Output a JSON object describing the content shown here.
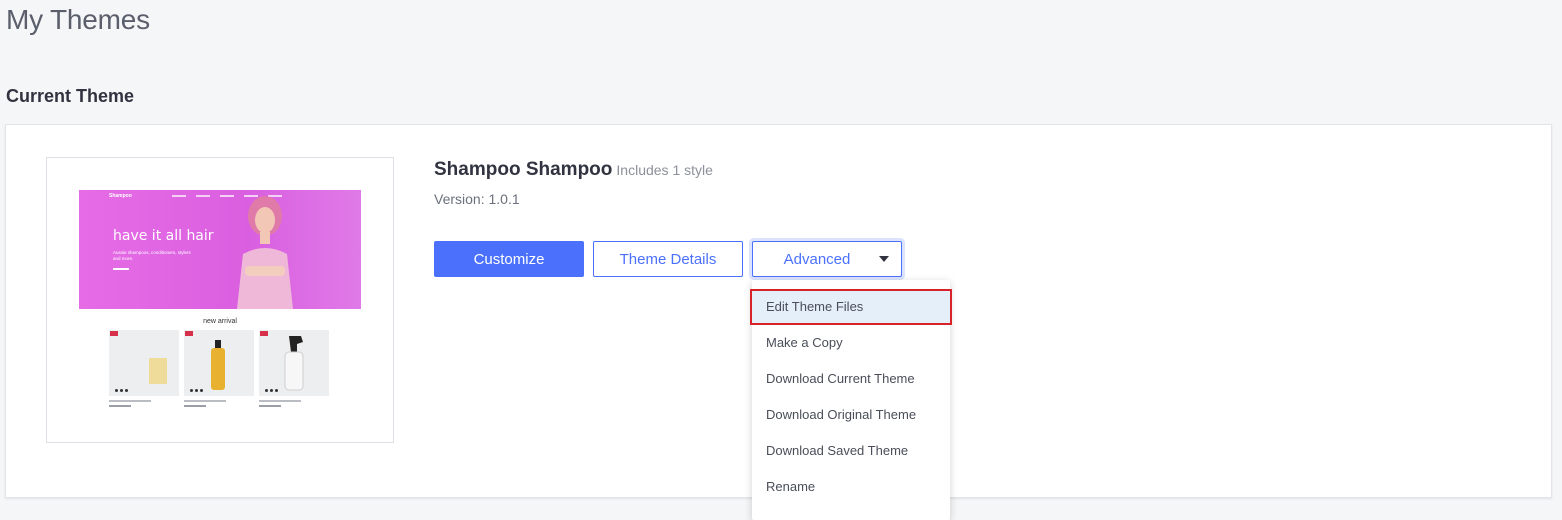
{
  "page": {
    "title": "My Themes"
  },
  "section": {
    "current_theme_label": "Current Theme"
  },
  "theme": {
    "name": "Shampoo Shampoo",
    "styles": "Includes 1 style",
    "version": "Version: 1.0.1",
    "preview": {
      "brand": "Shampoo",
      "headline": "have it all hair",
      "subtext": "Aussie shampoos, conditioners, stylers and more.",
      "section_heading": "new arrival"
    }
  },
  "actions": {
    "customize": "Customize",
    "theme_details": "Theme Details",
    "advanced": "Advanced"
  },
  "advanced_menu": {
    "items": [
      "Edit Theme Files",
      "Make a Copy",
      "Download Current Theme",
      "Download Original Theme",
      "Download Saved Theme",
      "Rename"
    ],
    "highlighted_index": 0
  },
  "colors": {
    "primary": "#4b71fc",
    "highlight_outline": "#d8232a",
    "hero_pink": "#e66ce6"
  }
}
